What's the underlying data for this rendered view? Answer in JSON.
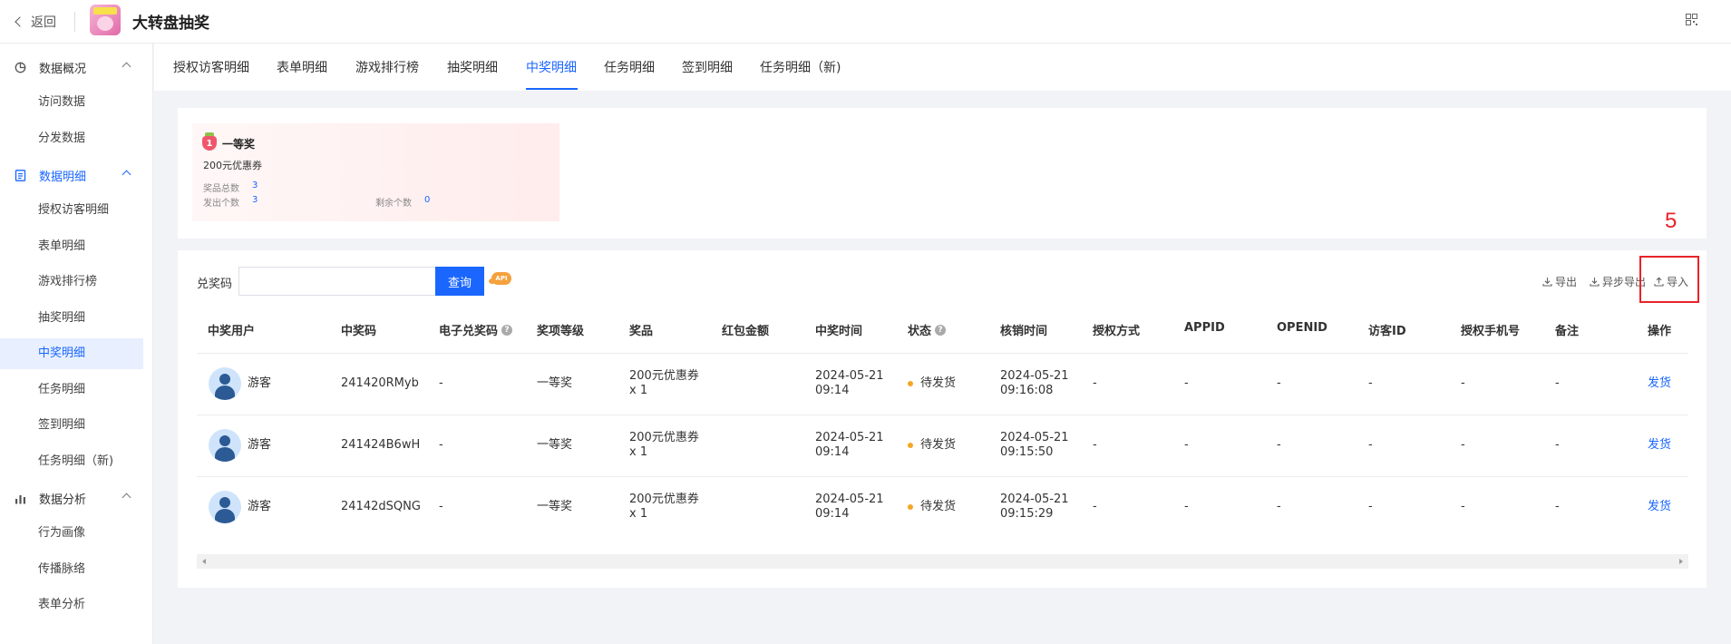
{
  "header": {
    "back_label": "返回",
    "app_title": "大转盘抽奖"
  },
  "sidebar": {
    "groups": [
      {
        "label": "数据概况",
        "items": [
          "访问数据",
          "分发数据"
        ]
      },
      {
        "label": "数据明细",
        "items": [
          "授权访客明细",
          "表单明细",
          "游戏排行榜",
          "抽奖明细",
          "中奖明细",
          "任务明细",
          "签到明细",
          "任务明细（新)"
        ]
      },
      {
        "label": "数据分析",
        "items": [
          "行为画像",
          "传播脉络",
          "表单分析"
        ]
      }
    ],
    "active_item": "中奖明细"
  },
  "tabs": [
    "授权访客明细",
    "表单明细",
    "游戏排行榜",
    "抽奖明细",
    "中奖明细",
    "任务明细",
    "签到明细",
    "任务明细（新)"
  ],
  "active_tab": "中奖明细",
  "prize_card": {
    "rank": "1",
    "name": "一等奖",
    "desc": "200元优惠券",
    "total_label": "奖品总数",
    "total_value": "3",
    "issued_label": "发出个数",
    "issued_value": "3",
    "remaining_label": "剩余个数",
    "remaining_value": "0"
  },
  "search": {
    "label": "兑奖码",
    "placeholder": "",
    "button": "查询",
    "api_badge": "API"
  },
  "toolbar": {
    "export": "导出",
    "async_export": "异步导出",
    "import": "导入"
  },
  "annotation": "5",
  "table": {
    "columns": [
      "中奖用户",
      "中奖码",
      "电子兑奖码",
      "奖项等级",
      "奖品",
      "红包金额",
      "中奖时间",
      "状态",
      "核销时间",
      "授权方式",
      "APPID",
      "OPENID",
      "访客ID",
      "授权手机号",
      "备注",
      "操作"
    ],
    "rows": [
      {
        "user": "游客",
        "code": "241420RMyb",
        "ecode": "-",
        "level": "一等奖",
        "prize_line1": "200元优惠券",
        "prize_line2": "x 1",
        "redpack": "",
        "win_date": "2024-05-21",
        "win_time": "09:14",
        "status": "待发货",
        "verify_date": "2024-05-21",
        "verify_time": "09:16:08",
        "auth": "-",
        "appid": "-",
        "openid": "-",
        "visitor": "-",
        "phone": "-",
        "remark": "-",
        "action": "发货"
      },
      {
        "user": "游客",
        "code": "241424B6wH",
        "ecode": "-",
        "level": "一等奖",
        "prize_line1": "200元优惠券",
        "prize_line2": "x 1",
        "redpack": "",
        "win_date": "2024-05-21",
        "win_time": "09:14",
        "status": "待发货",
        "verify_date": "2024-05-21",
        "verify_time": "09:15:50",
        "auth": "-",
        "appid": "-",
        "openid": "-",
        "visitor": "-",
        "phone": "-",
        "remark": "-",
        "action": "发货"
      },
      {
        "user": "游客",
        "code": "24142dSQNG",
        "ecode": "-",
        "level": "一等奖",
        "prize_line1": "200元优惠券",
        "prize_line2": "x 1",
        "redpack": "",
        "win_date": "2024-05-21",
        "win_time": "09:14",
        "status": "待发货",
        "verify_date": "2024-05-21",
        "verify_time": "09:15:29",
        "auth": "-",
        "appid": "-",
        "openid": "-",
        "visitor": "-",
        "phone": "-",
        "remark": "-",
        "action": "发货"
      }
    ]
  },
  "colors": {
    "accent": "#1a66ff",
    "status_pending": "#f5a623",
    "annotation": "#e8232a"
  }
}
